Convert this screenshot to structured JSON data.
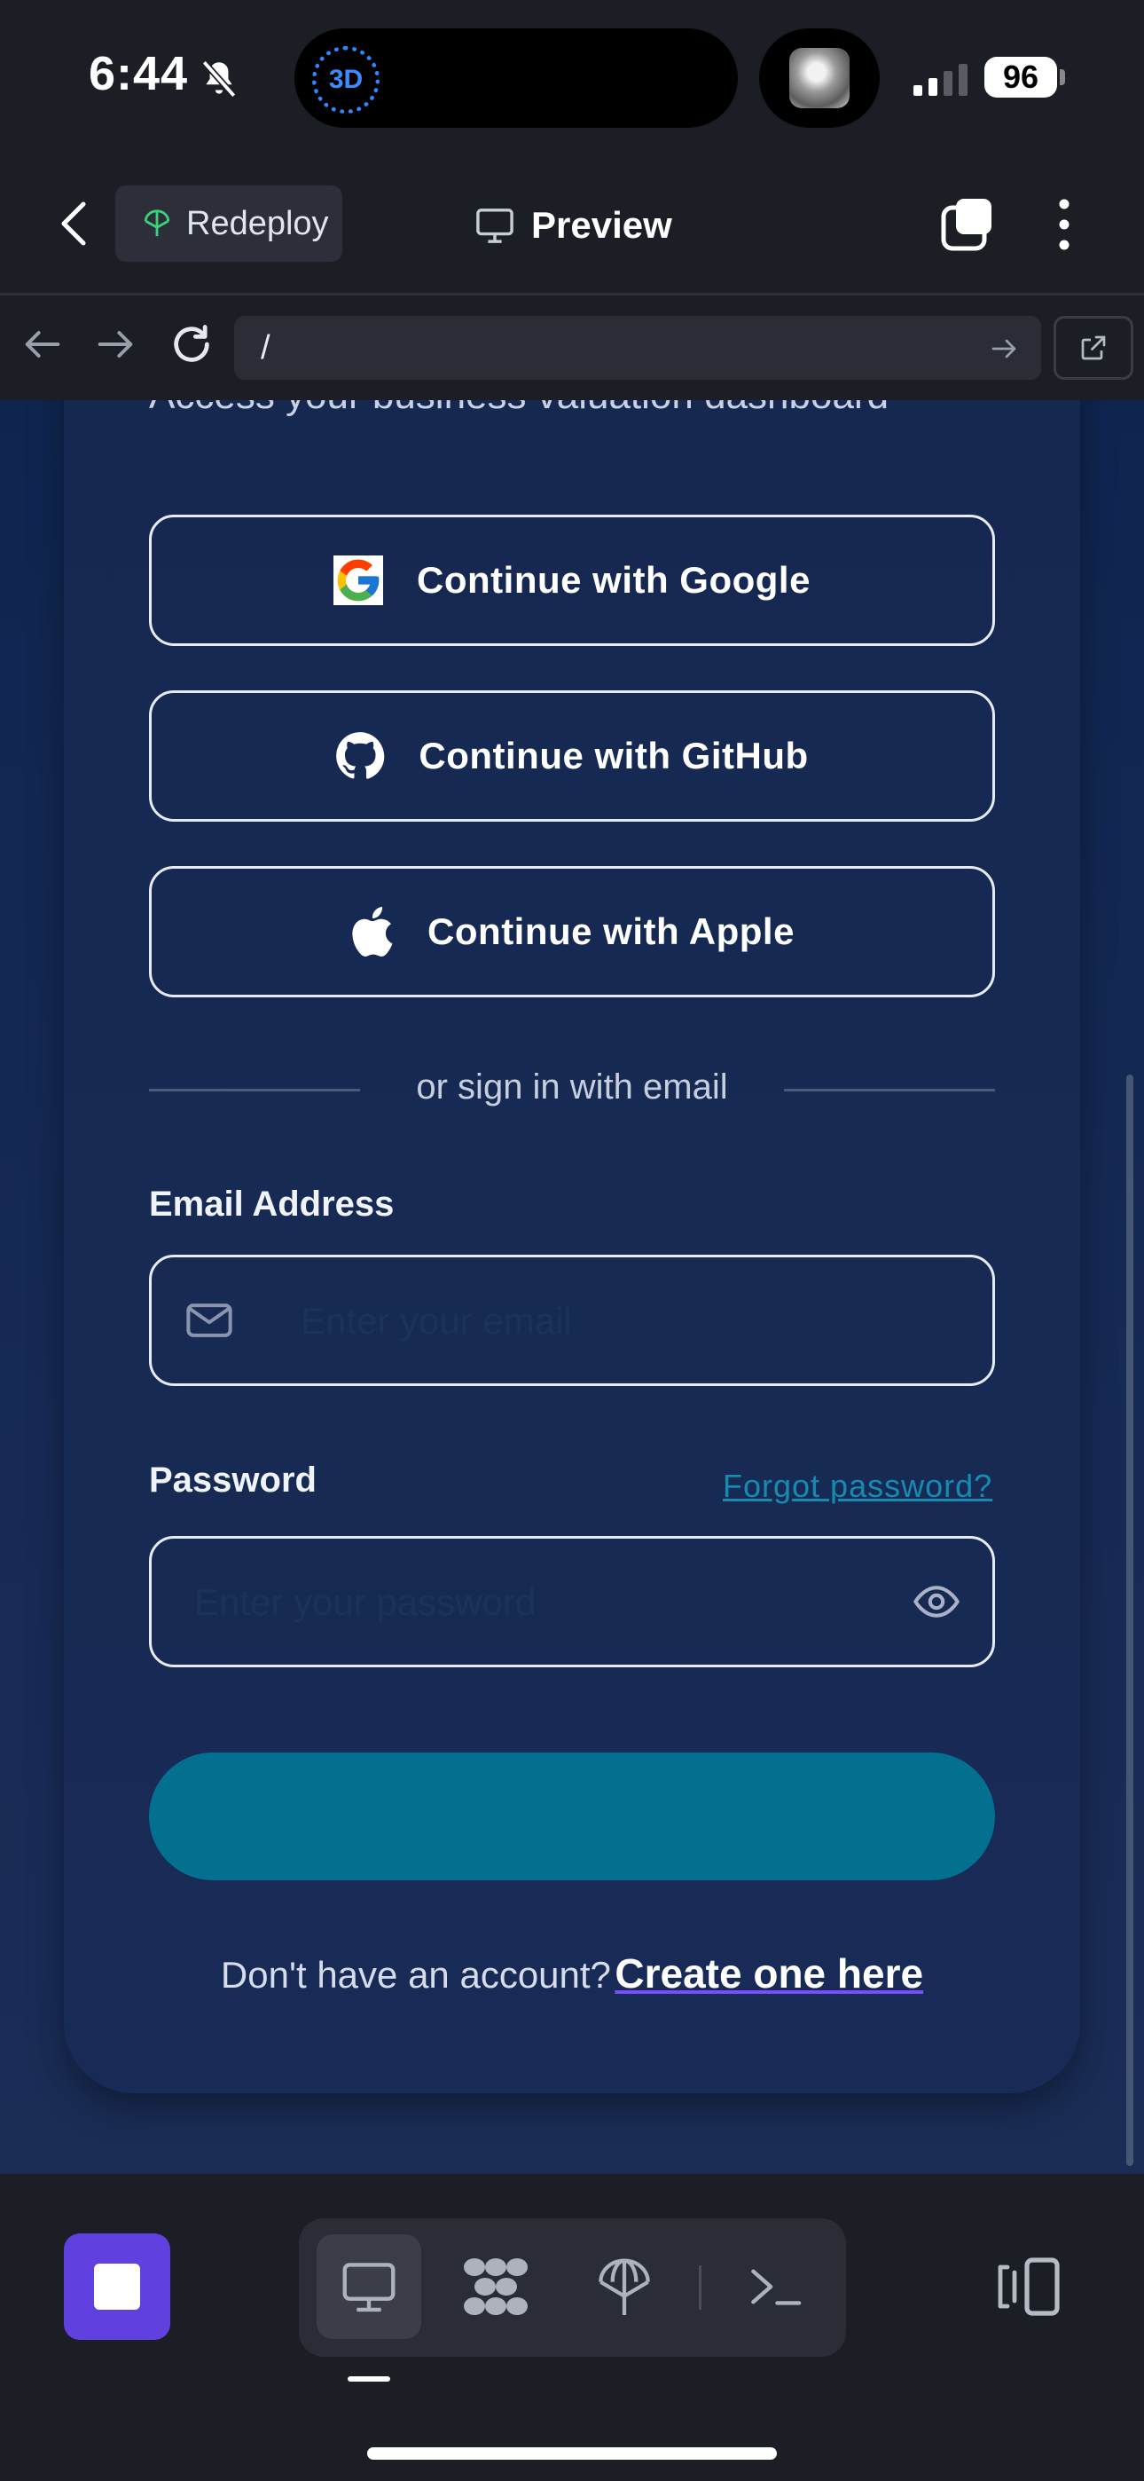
{
  "status_bar": {
    "time": "6:44",
    "island_badge": "3D",
    "battery": "96"
  },
  "header": {
    "redeploy_label": "Redeploy",
    "preview_label": "Preview"
  },
  "browser": {
    "url": "/"
  },
  "page": {
    "subtitle": "Access your business valuation dashboard",
    "oauth": {
      "google": "Continue with Google",
      "github": "Continue with GitHub",
      "apple": "Continue with Apple"
    },
    "divider": "or sign in with email",
    "email": {
      "label": "Email Address",
      "placeholder": "Enter your email"
    },
    "password": {
      "label": "Password",
      "placeholder": "Enter your password",
      "forgot": "Forgot password?"
    },
    "signup": {
      "question": "Don't have an account?",
      "link": "Create one here"
    }
  },
  "colors": {
    "accent_button": "#037090",
    "stop_button": "#6041e0",
    "link": "#178ab0"
  },
  "icons": [
    "bell-slash-icon",
    "signal-icon",
    "battery-icon",
    "back-chevron-icon",
    "redeploy-icon",
    "monitor-icon",
    "tabs-icon",
    "more-vertical-icon",
    "arrow-left-icon",
    "arrow-right-icon",
    "reload-icon",
    "open-external-icon",
    "google-icon",
    "github-icon",
    "apple-icon",
    "mail-icon",
    "eye-icon",
    "stop-icon",
    "desktop-icon",
    "grid-icon",
    "deploy-icon",
    "terminal-icon",
    "layout-switch-icon"
  ]
}
